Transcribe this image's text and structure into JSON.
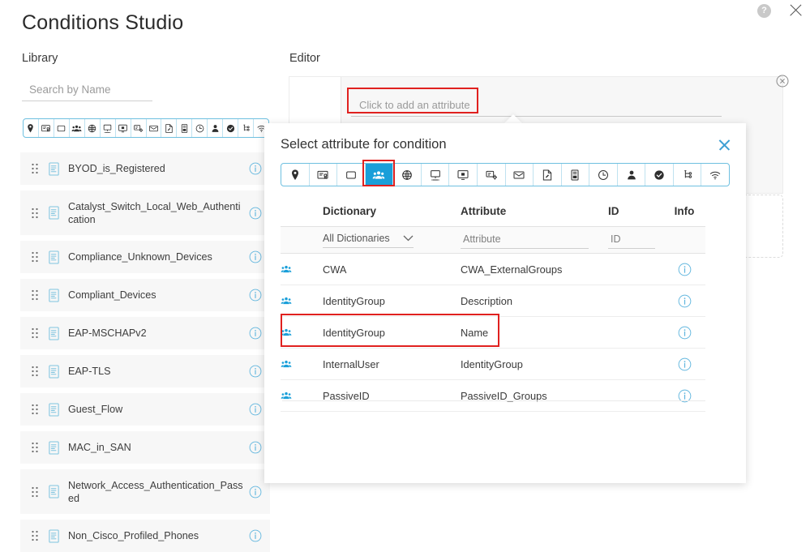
{
  "window": {
    "title": "Conditions Studio",
    "help_icon": "help-icon",
    "close_icon": "close-icon"
  },
  "library": {
    "heading": "Library",
    "search_placeholder": "Search by Name",
    "tab_icons": [
      "location-pin-icon",
      "certificate-icon",
      "box-icon",
      "group-icon",
      "globe-icon",
      "desktop-icon",
      "monitor-icon",
      "device-config-icon",
      "envelope-icon",
      "document-pen-icon",
      "server-icon",
      "clock-icon",
      "person-icon",
      "shield-check-icon",
      "network-tree-icon",
      "wifi-icon"
    ],
    "items": [
      {
        "label": "BYOD_is_Registered",
        "two_line": false
      },
      {
        "label": "Catalyst_Switch_Local_Web_Authentication",
        "two_line": true
      },
      {
        "label": "Compliance_Unknown_Devices",
        "two_line": false
      },
      {
        "label": "Compliant_Devices",
        "two_line": false
      },
      {
        "label": "EAP-MSCHAPv2",
        "two_line": false
      },
      {
        "label": "EAP-TLS",
        "two_line": false
      },
      {
        "label": "Guest_Flow",
        "two_line": false
      },
      {
        "label": "MAC_in_SAN",
        "two_line": false
      },
      {
        "label": "Network_Access_Authentication_Passed",
        "two_line": true
      },
      {
        "label": "Non_Cisco_Profiled_Phones",
        "two_line": false
      }
    ]
  },
  "editor": {
    "heading": "Editor",
    "attribute_placeholder": "Click to add an attribute",
    "close_icon": "circle-close-icon",
    "drop_zone": "dashed-drop-zone"
  },
  "modal": {
    "title": "Select attribute for condition",
    "close_icon": "close-icon",
    "selected_tab_index": 3,
    "tab_icons": [
      "location-pin-icon",
      "certificate-icon",
      "box-icon",
      "group-icon",
      "globe-icon",
      "desktop-icon",
      "monitor-icon",
      "device-config-icon",
      "envelope-icon",
      "document-pen-icon",
      "server-icon",
      "clock-icon",
      "person-icon",
      "shield-check-icon",
      "network-tree-icon",
      "wifi-icon"
    ],
    "table": {
      "columns": [
        "Dictionary",
        "Attribute",
        "ID",
        "Info"
      ],
      "filters": {
        "dictionary_value": "All Dictionaries",
        "attribute_placeholder": "Attribute",
        "id_placeholder": "ID"
      },
      "rows": [
        {
          "icon": "group-icon",
          "dictionary": "CWA",
          "attribute": "CWA_ExternalGroups",
          "id": "",
          "info": "info-icon",
          "highlighted": false
        },
        {
          "icon": "group-icon",
          "dictionary": "IdentityGroup",
          "attribute": "Description",
          "id": "",
          "info": "info-icon",
          "highlighted": false
        },
        {
          "icon": "group-icon",
          "dictionary": "IdentityGroup",
          "attribute": "Name",
          "id": "",
          "info": "info-icon",
          "highlighted": true
        },
        {
          "icon": "group-icon",
          "dictionary": "InternalUser",
          "attribute": "IdentityGroup",
          "id": "",
          "info": "info-icon",
          "highlighted": false
        },
        {
          "icon": "group-icon",
          "dictionary": "PassiveID",
          "attribute": "PassiveID_Groups",
          "id": "",
          "info": "info-icon",
          "highlighted": false
        }
      ]
    }
  },
  "colors": {
    "accent_blue": "#1a9fd9",
    "tab_border_blue": "#6fc0e0",
    "highlight_red": "#e0211f",
    "row_bg": "#f7f7f7",
    "text": "#3c3c3c"
  }
}
